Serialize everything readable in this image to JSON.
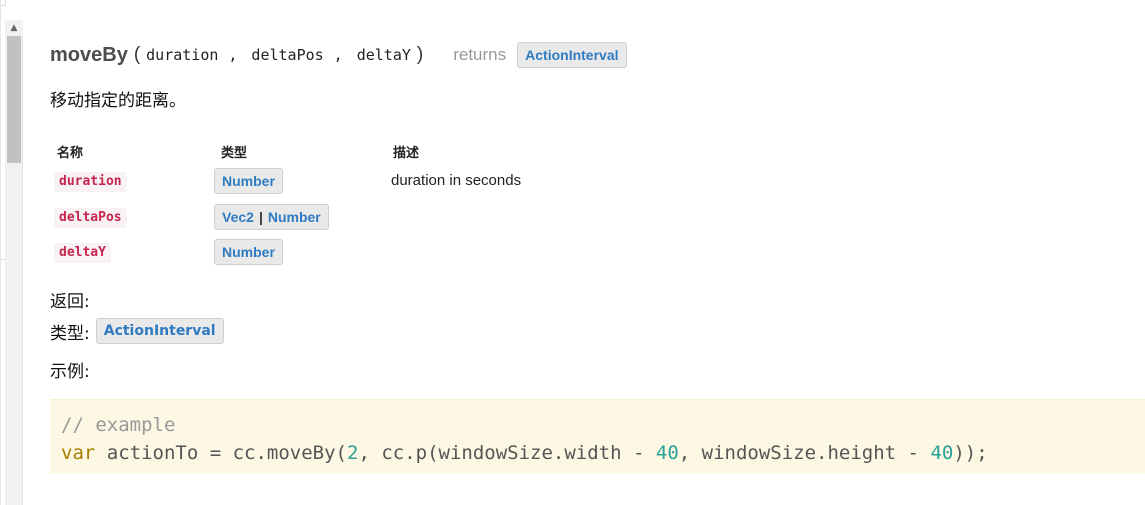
{
  "method": {
    "name": "moveBy",
    "open_paren": "(",
    "close_paren": ")",
    "params": [
      "duration",
      "deltaPos",
      "deltaY"
    ],
    "comma": ",",
    "returns_label": "returns",
    "return_type": "ActionInterval"
  },
  "description": "移动指定的距离。",
  "params_table": {
    "headers": [
      "名称",
      "类型",
      "描述"
    ],
    "rows": [
      {
        "name": "duration",
        "types": [
          "Number"
        ],
        "description": "duration in seconds"
      },
      {
        "name": "deltaPos",
        "types": [
          "Vec2",
          "Number"
        ],
        "type_separator": "|",
        "description": ""
      },
      {
        "name": "deltaY",
        "types": [
          "Number"
        ],
        "description": ""
      }
    ]
  },
  "returns_section": {
    "heading": "返回:",
    "type_label": "类型:",
    "type_value": "ActionInterval"
  },
  "example_section": {
    "heading": "示例:",
    "code": {
      "line1": "// example",
      "line2": {
        "kw": "var",
        "t1": " actionTo = cc.moveBy(",
        "n1": "2",
        "t2": ", cc.p(windowSize.width - ",
        "n2": "40",
        "t3": ", windowSize.height - ",
        "n3": "40",
        "t4": "));"
      }
    }
  },
  "colors": {
    "type_link": "#2f7bc1",
    "param_code": "#c7254e",
    "code_bg": "#fcf8e3",
    "keyword": "#a67f00",
    "number": "#2aa198"
  },
  "icons": {
    "scroll_up": "scroll-up-arrow-icon"
  }
}
